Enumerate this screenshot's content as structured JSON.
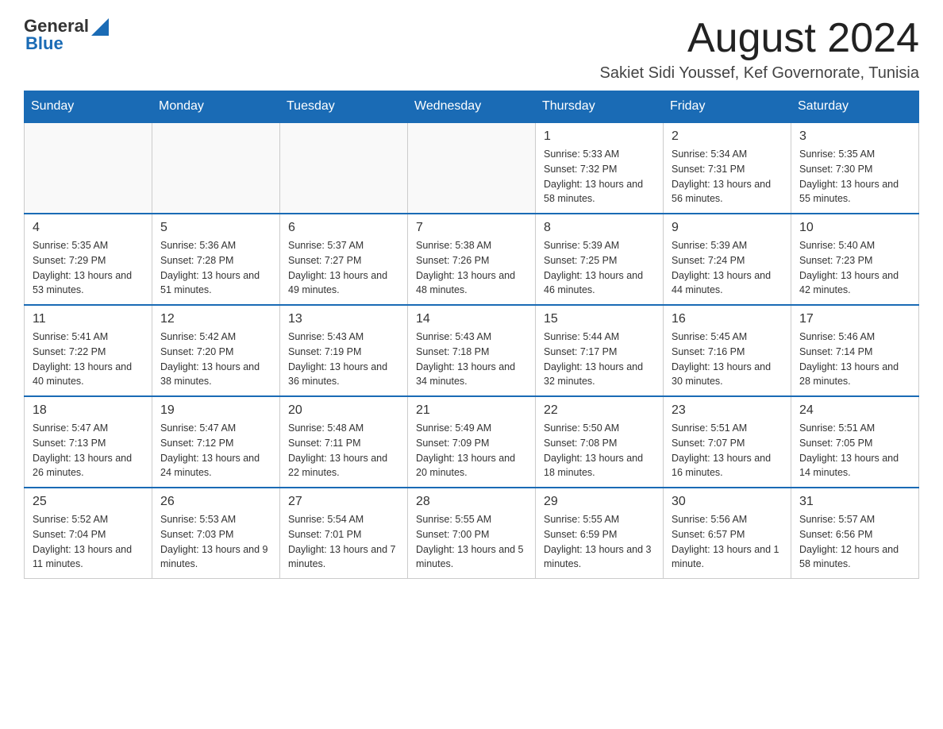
{
  "logo": {
    "general": "General",
    "blue": "Blue"
  },
  "title": "August 2024",
  "location": "Sakiet Sidi Youssef, Kef Governorate, Tunisia",
  "days_of_week": [
    "Sunday",
    "Monday",
    "Tuesday",
    "Wednesday",
    "Thursday",
    "Friday",
    "Saturday"
  ],
  "weeks": [
    [
      {
        "day": "",
        "info": ""
      },
      {
        "day": "",
        "info": ""
      },
      {
        "day": "",
        "info": ""
      },
      {
        "day": "",
        "info": ""
      },
      {
        "day": "1",
        "info": "Sunrise: 5:33 AM\nSunset: 7:32 PM\nDaylight: 13 hours and 58 minutes."
      },
      {
        "day": "2",
        "info": "Sunrise: 5:34 AM\nSunset: 7:31 PM\nDaylight: 13 hours and 56 minutes."
      },
      {
        "day": "3",
        "info": "Sunrise: 5:35 AM\nSunset: 7:30 PM\nDaylight: 13 hours and 55 minutes."
      }
    ],
    [
      {
        "day": "4",
        "info": "Sunrise: 5:35 AM\nSunset: 7:29 PM\nDaylight: 13 hours and 53 minutes."
      },
      {
        "day": "5",
        "info": "Sunrise: 5:36 AM\nSunset: 7:28 PM\nDaylight: 13 hours and 51 minutes."
      },
      {
        "day": "6",
        "info": "Sunrise: 5:37 AM\nSunset: 7:27 PM\nDaylight: 13 hours and 49 minutes."
      },
      {
        "day": "7",
        "info": "Sunrise: 5:38 AM\nSunset: 7:26 PM\nDaylight: 13 hours and 48 minutes."
      },
      {
        "day": "8",
        "info": "Sunrise: 5:39 AM\nSunset: 7:25 PM\nDaylight: 13 hours and 46 minutes."
      },
      {
        "day": "9",
        "info": "Sunrise: 5:39 AM\nSunset: 7:24 PM\nDaylight: 13 hours and 44 minutes."
      },
      {
        "day": "10",
        "info": "Sunrise: 5:40 AM\nSunset: 7:23 PM\nDaylight: 13 hours and 42 minutes."
      }
    ],
    [
      {
        "day": "11",
        "info": "Sunrise: 5:41 AM\nSunset: 7:22 PM\nDaylight: 13 hours and 40 minutes."
      },
      {
        "day": "12",
        "info": "Sunrise: 5:42 AM\nSunset: 7:20 PM\nDaylight: 13 hours and 38 minutes."
      },
      {
        "day": "13",
        "info": "Sunrise: 5:43 AM\nSunset: 7:19 PM\nDaylight: 13 hours and 36 minutes."
      },
      {
        "day": "14",
        "info": "Sunrise: 5:43 AM\nSunset: 7:18 PM\nDaylight: 13 hours and 34 minutes."
      },
      {
        "day": "15",
        "info": "Sunrise: 5:44 AM\nSunset: 7:17 PM\nDaylight: 13 hours and 32 minutes."
      },
      {
        "day": "16",
        "info": "Sunrise: 5:45 AM\nSunset: 7:16 PM\nDaylight: 13 hours and 30 minutes."
      },
      {
        "day": "17",
        "info": "Sunrise: 5:46 AM\nSunset: 7:14 PM\nDaylight: 13 hours and 28 minutes."
      }
    ],
    [
      {
        "day": "18",
        "info": "Sunrise: 5:47 AM\nSunset: 7:13 PM\nDaylight: 13 hours and 26 minutes."
      },
      {
        "day": "19",
        "info": "Sunrise: 5:47 AM\nSunset: 7:12 PM\nDaylight: 13 hours and 24 minutes."
      },
      {
        "day": "20",
        "info": "Sunrise: 5:48 AM\nSunset: 7:11 PM\nDaylight: 13 hours and 22 minutes."
      },
      {
        "day": "21",
        "info": "Sunrise: 5:49 AM\nSunset: 7:09 PM\nDaylight: 13 hours and 20 minutes."
      },
      {
        "day": "22",
        "info": "Sunrise: 5:50 AM\nSunset: 7:08 PM\nDaylight: 13 hours and 18 minutes."
      },
      {
        "day": "23",
        "info": "Sunrise: 5:51 AM\nSunset: 7:07 PM\nDaylight: 13 hours and 16 minutes."
      },
      {
        "day": "24",
        "info": "Sunrise: 5:51 AM\nSunset: 7:05 PM\nDaylight: 13 hours and 14 minutes."
      }
    ],
    [
      {
        "day": "25",
        "info": "Sunrise: 5:52 AM\nSunset: 7:04 PM\nDaylight: 13 hours and 11 minutes."
      },
      {
        "day": "26",
        "info": "Sunrise: 5:53 AM\nSunset: 7:03 PM\nDaylight: 13 hours and 9 minutes."
      },
      {
        "day": "27",
        "info": "Sunrise: 5:54 AM\nSunset: 7:01 PM\nDaylight: 13 hours and 7 minutes."
      },
      {
        "day": "28",
        "info": "Sunrise: 5:55 AM\nSunset: 7:00 PM\nDaylight: 13 hours and 5 minutes."
      },
      {
        "day": "29",
        "info": "Sunrise: 5:55 AM\nSunset: 6:59 PM\nDaylight: 13 hours and 3 minutes."
      },
      {
        "day": "30",
        "info": "Sunrise: 5:56 AM\nSunset: 6:57 PM\nDaylight: 13 hours and 1 minute."
      },
      {
        "day": "31",
        "info": "Sunrise: 5:57 AM\nSunset: 6:56 PM\nDaylight: 12 hours and 58 minutes."
      }
    ]
  ]
}
